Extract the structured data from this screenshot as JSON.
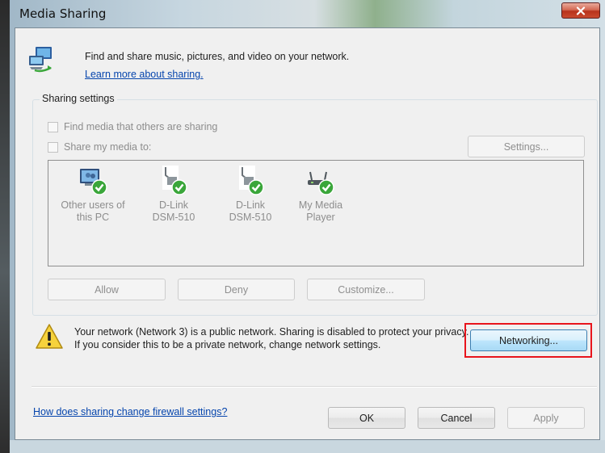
{
  "window": {
    "title": "Media Sharing"
  },
  "header": {
    "description": "Find and share music, pictures, and video on your network.",
    "learn_more": "Learn more about sharing."
  },
  "sharing_settings": {
    "group_label": "Sharing settings",
    "find_media_label": "Find media that others are sharing",
    "find_media_checked": false,
    "share_media_label": "Share my media to:",
    "share_media_checked": false,
    "settings_button": "Settings..."
  },
  "devices": [
    {
      "name_line1": "Other users of",
      "name_line2": "this PC",
      "icon": "computer-users-icon",
      "status": "allowed"
    },
    {
      "name_line1": "D-Link",
      "name_line2": "DSM-510",
      "icon": "media-device-icon",
      "status": "allowed"
    },
    {
      "name_line1": "D-Link",
      "name_line2": "DSM-510",
      "icon": "media-device-icon",
      "status": "allowed"
    },
    {
      "name_line1": "My Media",
      "name_line2": "Player",
      "icon": "router-icon",
      "status": "allowed"
    }
  ],
  "device_actions": {
    "allow": "Allow",
    "deny": "Deny",
    "customize": "Customize..."
  },
  "warning": {
    "message": "Your network (Network  3) is a public network. Sharing is disabled to protect your privacy. If you consider this to be a private network, change network settings.",
    "networking_button": "Networking..."
  },
  "footer": {
    "firewall_link": "How does sharing change firewall settings?",
    "ok": "OK",
    "cancel": "Cancel",
    "apply": "Apply"
  },
  "colors": {
    "highlight_border": "#e8141c",
    "link": "#0645ad",
    "check_green": "#3aa63a"
  }
}
